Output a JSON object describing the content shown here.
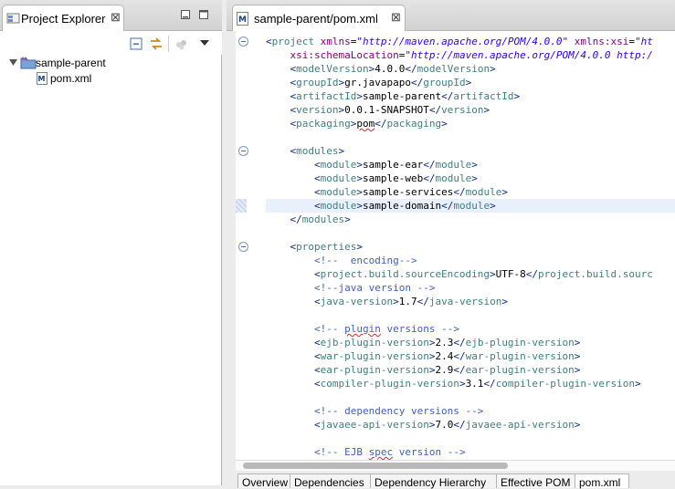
{
  "explorer": {
    "tab_label": "Project Explorer",
    "close_glyph": "⊠",
    "tree": [
      {
        "label": "sample-parent",
        "type": "project",
        "expanded": true
      },
      {
        "label": "pom.xml",
        "type": "maven-file"
      }
    ]
  },
  "editor": {
    "tab_label": "sample-parent/pom.xml",
    "close_glyph": "⊠",
    "lines": [
      [
        [
          "b",
          "<"
        ],
        [
          "e",
          "project"
        ],
        [
          "t",
          " "
        ],
        [
          "a",
          "xmlns"
        ],
        [
          "t",
          "="
        ],
        [
          "s",
          "\"http://maven.apache.org/POM/4.0.0\""
        ],
        [
          "t",
          " "
        ],
        [
          "a",
          "xmlns:xsi"
        ],
        [
          "t",
          "="
        ],
        [
          "s",
          "\"ht"
        ]
      ],
      [
        [
          "t",
          "    "
        ],
        [
          "a",
          "xsi:schemaLocation"
        ],
        [
          "t",
          "="
        ],
        [
          "s",
          "\"http://maven.apache.org/POM/4.0.0 http:/"
        ]
      ],
      [
        [
          "t",
          "    "
        ],
        [
          "b",
          "<"
        ],
        [
          "e",
          "modelVersion"
        ],
        [
          "b",
          ">"
        ],
        [
          "t",
          "4.0.0"
        ],
        [
          "b",
          "</"
        ],
        [
          "e",
          "modelVersion"
        ],
        [
          "b",
          ">"
        ]
      ],
      [
        [
          "t",
          "    "
        ],
        [
          "b",
          "<"
        ],
        [
          "e",
          "groupId"
        ],
        [
          "b",
          ">"
        ],
        [
          "t",
          "gr.javapapo"
        ],
        [
          "b",
          "</"
        ],
        [
          "e",
          "groupId"
        ],
        [
          "b",
          ">"
        ]
      ],
      [
        [
          "t",
          "    "
        ],
        [
          "b",
          "<"
        ],
        [
          "e",
          "artifactId"
        ],
        [
          "b",
          ">"
        ],
        [
          "t",
          "sample-parent"
        ],
        [
          "b",
          "</"
        ],
        [
          "e",
          "artifactId"
        ],
        [
          "b",
          ">"
        ]
      ],
      [
        [
          "t",
          "    "
        ],
        [
          "b",
          "<"
        ],
        [
          "e",
          "version"
        ],
        [
          "b",
          ">"
        ],
        [
          "t",
          "0.0.1-SNAPSHOT"
        ],
        [
          "b",
          "</"
        ],
        [
          "e",
          "version"
        ],
        [
          "b",
          ">"
        ]
      ],
      [
        [
          "t",
          "    "
        ],
        [
          "b",
          "<"
        ],
        [
          "e",
          "packaging"
        ],
        [
          "b",
          ">"
        ],
        [
          "tsq",
          "pom"
        ],
        [
          "b",
          "</"
        ],
        [
          "e",
          "packaging"
        ],
        [
          "b",
          ">"
        ]
      ],
      [],
      [
        [
          "t",
          "    "
        ],
        [
          "b",
          "<"
        ],
        [
          "e",
          "modules"
        ],
        [
          "b",
          ">"
        ]
      ],
      [
        [
          "t",
          "        "
        ],
        [
          "b",
          "<"
        ],
        [
          "e",
          "module"
        ],
        [
          "b",
          ">"
        ],
        [
          "t",
          "sample-ear"
        ],
        [
          "b",
          "</"
        ],
        [
          "e",
          "module"
        ],
        [
          "b",
          ">"
        ]
      ],
      [
        [
          "t",
          "        "
        ],
        [
          "b",
          "<"
        ],
        [
          "e",
          "module"
        ],
        [
          "b",
          ">"
        ],
        [
          "t",
          "sample-web"
        ],
        [
          "b",
          "</"
        ],
        [
          "e",
          "module"
        ],
        [
          "b",
          ">"
        ]
      ],
      [
        [
          "t",
          "        "
        ],
        [
          "b",
          "<"
        ],
        [
          "e",
          "module"
        ],
        [
          "b",
          ">"
        ],
        [
          "t",
          "sample-services"
        ],
        [
          "b",
          "</"
        ],
        [
          "e",
          "module"
        ],
        [
          "b",
          ">"
        ]
      ],
      [
        [
          "t",
          "        "
        ],
        [
          "b",
          "<"
        ],
        [
          "e",
          "module"
        ],
        [
          "b",
          ">"
        ],
        [
          "t",
          "sample-domain"
        ],
        [
          "b",
          "</"
        ],
        [
          "e",
          "module"
        ],
        [
          "b",
          ">"
        ]
      ],
      [
        [
          "t",
          "    "
        ],
        [
          "b",
          "</"
        ],
        [
          "e",
          "modules"
        ],
        [
          "b",
          ">"
        ]
      ],
      [],
      [
        [
          "t",
          "    "
        ],
        [
          "b",
          "<"
        ],
        [
          "e",
          "properties"
        ],
        [
          "b",
          ">"
        ]
      ],
      [
        [
          "t",
          "        "
        ],
        [
          "c",
          "<!--  encoding-->"
        ]
      ],
      [
        [
          "t",
          "        "
        ],
        [
          "b",
          "<"
        ],
        [
          "e",
          "project.build.sourceEncoding"
        ],
        [
          "b",
          ">"
        ],
        [
          "t",
          "UTF-8"
        ],
        [
          "b",
          "</"
        ],
        [
          "e",
          "project.build.sourc"
        ]
      ],
      [
        [
          "t",
          "        "
        ],
        [
          "c",
          "<!--java version -->"
        ]
      ],
      [
        [
          "t",
          "        "
        ],
        [
          "b",
          "<"
        ],
        [
          "e",
          "java-version"
        ],
        [
          "b",
          ">"
        ],
        [
          "t",
          "1.7"
        ],
        [
          "b",
          "</"
        ],
        [
          "e",
          "java-version"
        ],
        [
          "b",
          ">"
        ]
      ],
      [],
      [
        [
          "t",
          "        "
        ],
        [
          "c",
          "<!-- "
        ],
        [
          "csq",
          "plugin"
        ],
        [
          "c",
          " versions -->"
        ]
      ],
      [
        [
          "t",
          "        "
        ],
        [
          "b",
          "<"
        ],
        [
          "e",
          "ejb-plugin-version"
        ],
        [
          "b",
          ">"
        ],
        [
          "t",
          "2.3"
        ],
        [
          "b",
          "</"
        ],
        [
          "e",
          "ejb-plugin-version"
        ],
        [
          "b",
          ">"
        ]
      ],
      [
        [
          "t",
          "        "
        ],
        [
          "b",
          "<"
        ],
        [
          "e",
          "war-plugin-version"
        ],
        [
          "b",
          ">"
        ],
        [
          "t",
          "2.4"
        ],
        [
          "b",
          "</"
        ],
        [
          "e",
          "war-plugin-version"
        ],
        [
          "b",
          ">"
        ]
      ],
      [
        [
          "t",
          "        "
        ],
        [
          "b",
          "<"
        ],
        [
          "e",
          "ear-plugin-version"
        ],
        [
          "b",
          ">"
        ],
        [
          "t",
          "2.9"
        ],
        [
          "b",
          "</"
        ],
        [
          "e",
          "ear-plugin-version"
        ],
        [
          "b",
          ">"
        ]
      ],
      [
        [
          "t",
          "        "
        ],
        [
          "b",
          "<"
        ],
        [
          "e",
          "compiler-plugin-version"
        ],
        [
          "b",
          ">"
        ],
        [
          "t",
          "3.1"
        ],
        [
          "b",
          "</"
        ],
        [
          "e",
          "compiler-plugin-version"
        ],
        [
          "b",
          ">"
        ]
      ],
      [],
      [
        [
          "t",
          "        "
        ],
        [
          "c",
          "<!-- dependency versions -->"
        ]
      ],
      [
        [
          "t",
          "        "
        ],
        [
          "b",
          "<"
        ],
        [
          "e",
          "javaee-api-version"
        ],
        [
          "b",
          ">"
        ],
        [
          "t",
          "7.0"
        ],
        [
          "b",
          "</"
        ],
        [
          "e",
          "javaee-api-version"
        ],
        [
          "b",
          ">"
        ]
      ],
      [],
      [
        [
          "t",
          "        "
        ],
        [
          "c",
          "<!-- EJB "
        ],
        [
          "csq",
          "spec"
        ],
        [
          "c",
          " version -->"
        ]
      ]
    ],
    "highlighted_line": 12,
    "fold_lines": [
      0,
      8,
      15
    ]
  },
  "bottom_tabs": [
    {
      "label": "Overview",
      "active": false
    },
    {
      "label": "Dependencies",
      "active": false
    },
    {
      "label": "Dependency Hierarchy",
      "active": false
    },
    {
      "label": "Effective POM",
      "active": false
    },
    {
      "label": "pom.xml",
      "active": true
    }
  ]
}
